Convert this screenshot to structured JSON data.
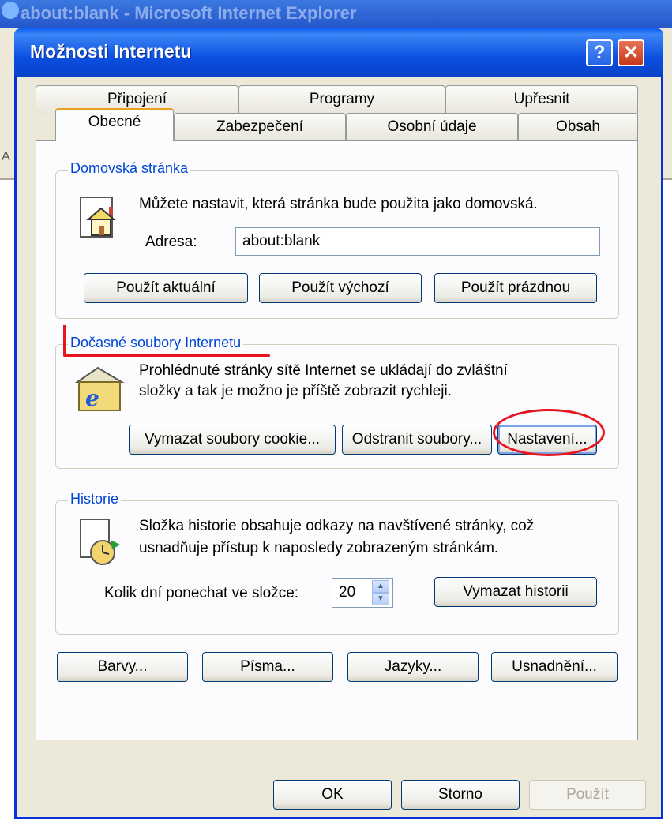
{
  "background_window": {
    "title": "about:blank - Microsoft Internet Explorer",
    "letter": "A"
  },
  "dialog": {
    "title": "Možnosti Internetu",
    "help_label": "?",
    "close_label": "✕"
  },
  "tabs": {
    "row1": [
      "Připojení",
      "Programy",
      "Upřesnit"
    ],
    "row2": [
      "Obecné",
      "Zabezpečení",
      "Osobní údaje",
      "Obsah"
    ],
    "active": "Obecné"
  },
  "home": {
    "legend": "Domovská stránka",
    "description": "Můžete nastavit, která stránka bude použita jako domovská.",
    "address_label": "Adresa:",
    "address_value": "about:blank",
    "buttons": [
      "Použít aktuální",
      "Použít výchozí",
      "Použít prázdnou"
    ]
  },
  "temp": {
    "legend": "Dočasné soubory Internetu",
    "line1": "Prohlédnuté stránky sítě Internet se ukládají do zvláštní",
    "line2": "složky a tak je možno je příště zobrazit rychleji.",
    "buttons": [
      "Vymazat soubory cookie...",
      "Odstranit soubory...",
      "Nastavení..."
    ]
  },
  "history": {
    "legend": "Historie",
    "line1": "Složka historie obsahuje odkazy na navštívené stránky, což",
    "line2": "usnadňuje přístup k naposledy zobrazeným stránkám.",
    "days_label": "Kolik dní ponechat ve složce:",
    "days_value": "20",
    "clear_label": "Vymazat historii"
  },
  "bottom_buttons": [
    "Barvy...",
    "Písma...",
    "Jazyky...",
    "Usnadnění..."
  ],
  "dialog_buttons": {
    "ok": "OK",
    "cancel": "Storno",
    "apply": "Použít"
  },
  "colors": {
    "annotation": "#e8141e",
    "titlebar": "#0a5df5",
    "legend": "#0046d5"
  }
}
